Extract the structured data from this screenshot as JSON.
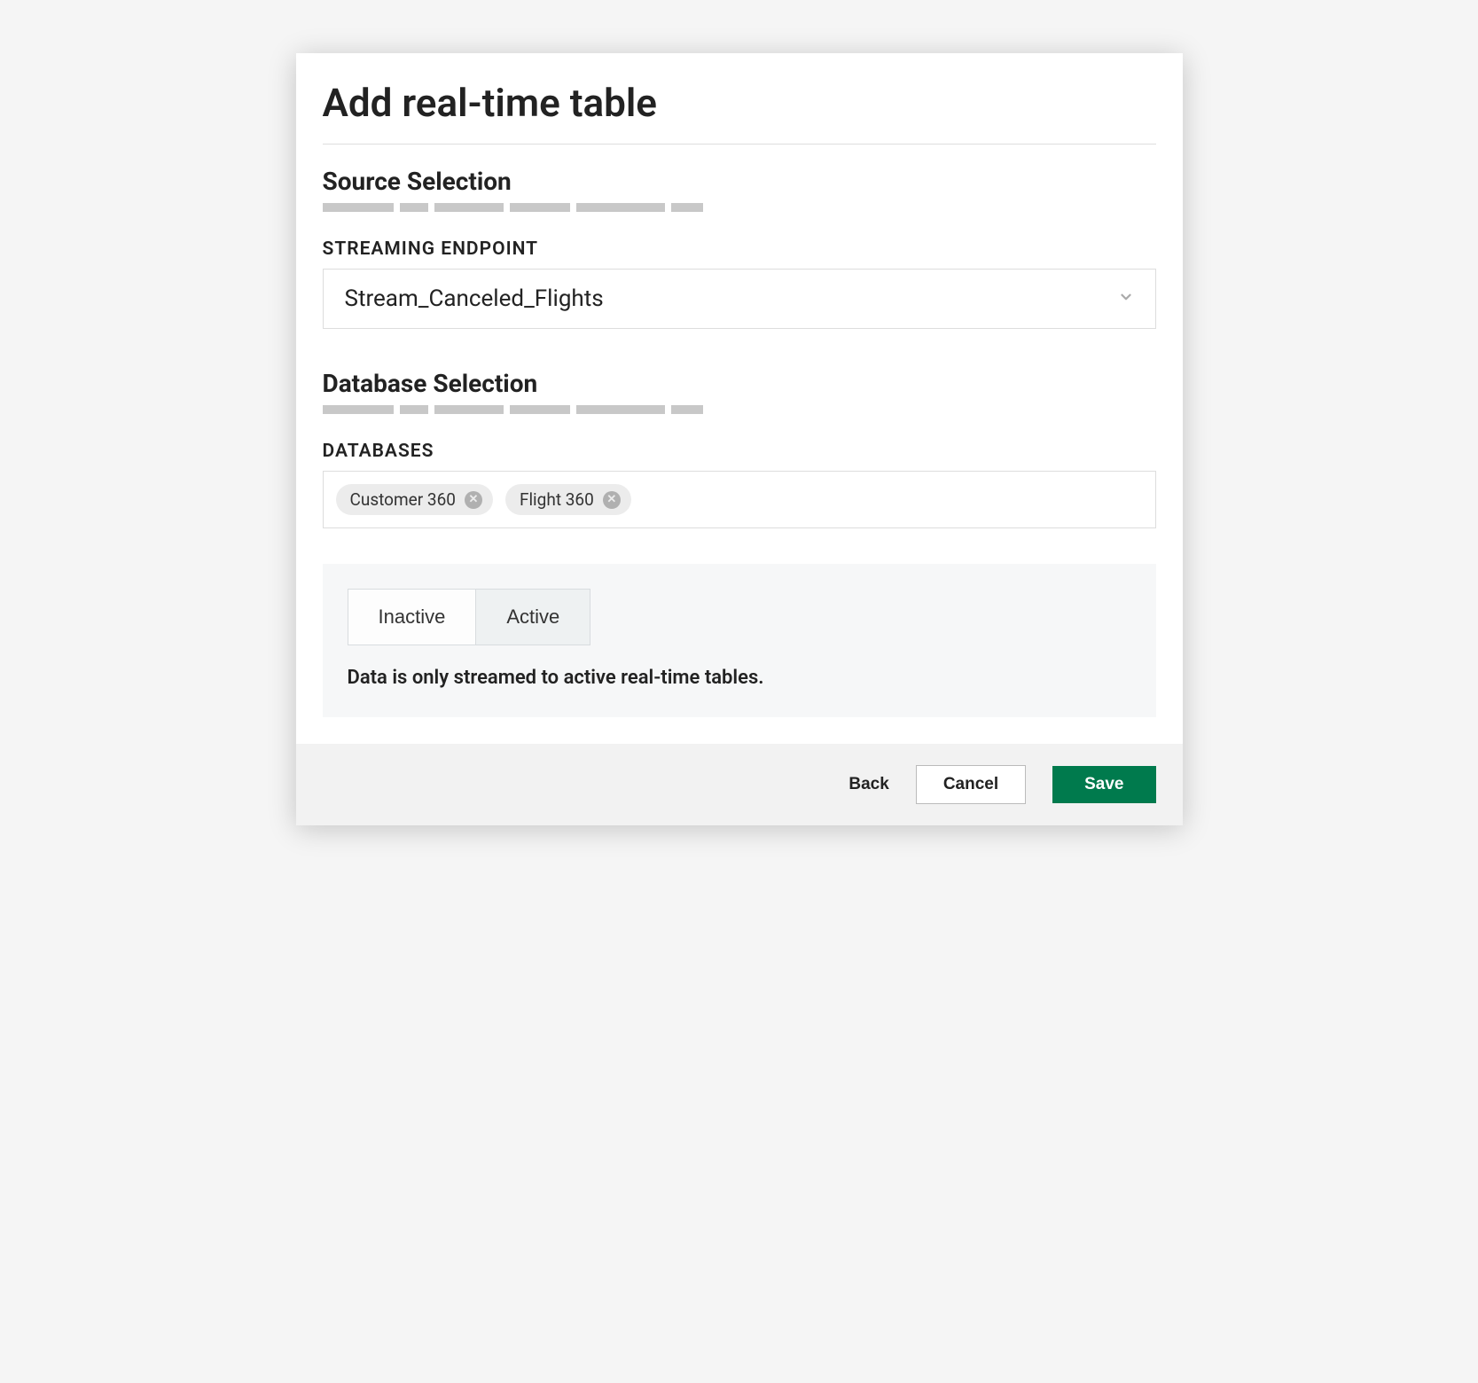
{
  "modal": {
    "title": "Add real-time table"
  },
  "source": {
    "heading": "Source Selection",
    "endpoint_label": "STREAMING ENDPOINT",
    "endpoint_value": "Stream_Canceled_Flights"
  },
  "database": {
    "heading": "Database Selection",
    "label": "DATABASES",
    "chips": [
      {
        "label": "Customer 360"
      },
      {
        "label": "Flight 360"
      }
    ]
  },
  "status": {
    "toggle": {
      "inactive_label": "Inactive",
      "active_label": "Active",
      "selected": "Active"
    },
    "description": "Data is only streamed to active real-time tables."
  },
  "footer": {
    "back_label": "Back",
    "cancel_label": "Cancel",
    "save_label": "Save"
  },
  "colors": {
    "primary": "#007a4d"
  }
}
